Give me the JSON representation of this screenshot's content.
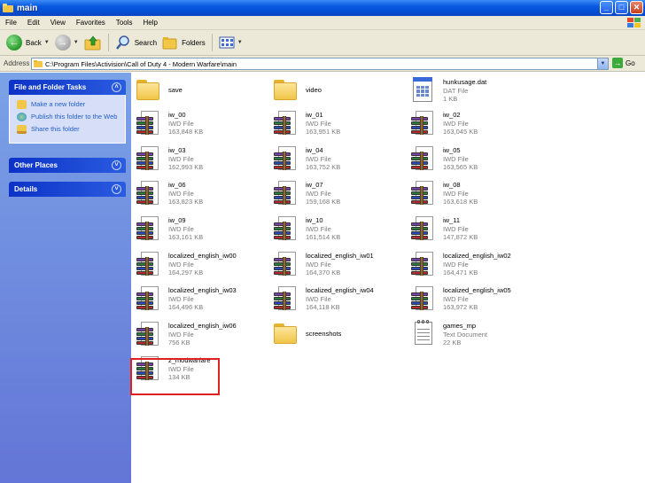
{
  "window": {
    "title": "main",
    "buttons": [
      "_",
      "□",
      "✕"
    ]
  },
  "menu": [
    "File",
    "Edit",
    "View",
    "Favorites",
    "Tools",
    "Help"
  ],
  "toolbar": {
    "back": "Back",
    "search": "Search",
    "folders": "Folders"
  },
  "address": {
    "label": "Address",
    "path": "C:\\Program Files\\Activision\\Call of Duty 4 - Modern Warfare\\main",
    "go": "Go"
  },
  "taskpane": {
    "file_folder_tasks": {
      "title": "File and Folder Tasks",
      "tasks": [
        "Make a new folder",
        "Publish this folder to the Web",
        "Share this folder"
      ]
    },
    "other_places": "Other Places",
    "details": "Details"
  },
  "files": [
    {
      "name": "save",
      "kind": "folder"
    },
    {
      "name": "video",
      "kind": "folder"
    },
    {
      "name": "hunkusage.dat",
      "kind": "dat",
      "type": "DAT File",
      "size": "1 KB"
    },
    {
      "name": "iw_00",
      "kind": "iwd",
      "type": "IWD File",
      "size": "163,848 KB"
    },
    {
      "name": "iw_01",
      "kind": "iwd",
      "type": "IWD File",
      "size": "163,951 KB"
    },
    {
      "name": "iw_02",
      "kind": "iwd",
      "type": "IWD File",
      "size": "163,045 KB"
    },
    {
      "name": "iw_03",
      "kind": "iwd",
      "type": "IWD File",
      "size": "162,993 KB"
    },
    {
      "name": "iw_04",
      "kind": "iwd",
      "type": "IWD File",
      "size": "163,752 KB"
    },
    {
      "name": "iw_05",
      "kind": "iwd",
      "type": "IWD File",
      "size": "163,565 KB"
    },
    {
      "name": "iw_06",
      "kind": "iwd",
      "type": "IWD File",
      "size": "163,823 KB"
    },
    {
      "name": "iw_07",
      "kind": "iwd",
      "type": "IWD File",
      "size": "159,168 KB"
    },
    {
      "name": "iw_08",
      "kind": "iwd",
      "type": "IWD File",
      "size": "163,618 KB"
    },
    {
      "name": "iw_09",
      "kind": "iwd",
      "type": "IWD File",
      "size": "163,161 KB"
    },
    {
      "name": "iw_10",
      "kind": "iwd",
      "type": "IWD File",
      "size": "161,514 KB"
    },
    {
      "name": "iw_11",
      "kind": "iwd",
      "type": "IWD File",
      "size": "147,872 KB"
    },
    {
      "name": "localized_english_iw00",
      "kind": "iwd",
      "type": "IWD File",
      "size": "164,297 KB"
    },
    {
      "name": "localized_english_iw01",
      "kind": "iwd",
      "type": "IWD File",
      "size": "164,370 KB"
    },
    {
      "name": "localized_english_iw02",
      "kind": "iwd",
      "type": "IWD File",
      "size": "164,471 KB"
    },
    {
      "name": "localized_english_iw03",
      "kind": "iwd",
      "type": "IWD File",
      "size": "164,496 KB"
    },
    {
      "name": "localized_english_iw04",
      "kind": "iwd",
      "type": "IWD File",
      "size": "164,118 KB"
    },
    {
      "name": "localized_english_iw05",
      "kind": "iwd",
      "type": "IWD File",
      "size": "163,972 KB"
    },
    {
      "name": "localized_english_iw06",
      "kind": "iwd",
      "type": "IWD File",
      "size": "756 KB"
    },
    {
      "name": "screenshots",
      "kind": "folder"
    },
    {
      "name": "games_mp",
      "kind": "txt",
      "type": "Text Document",
      "size": "22 KB"
    },
    {
      "name": "z_modwarfare",
      "kind": "iwd",
      "type": "IWD File",
      "size": "134 KB",
      "highlighted": true
    }
  ]
}
